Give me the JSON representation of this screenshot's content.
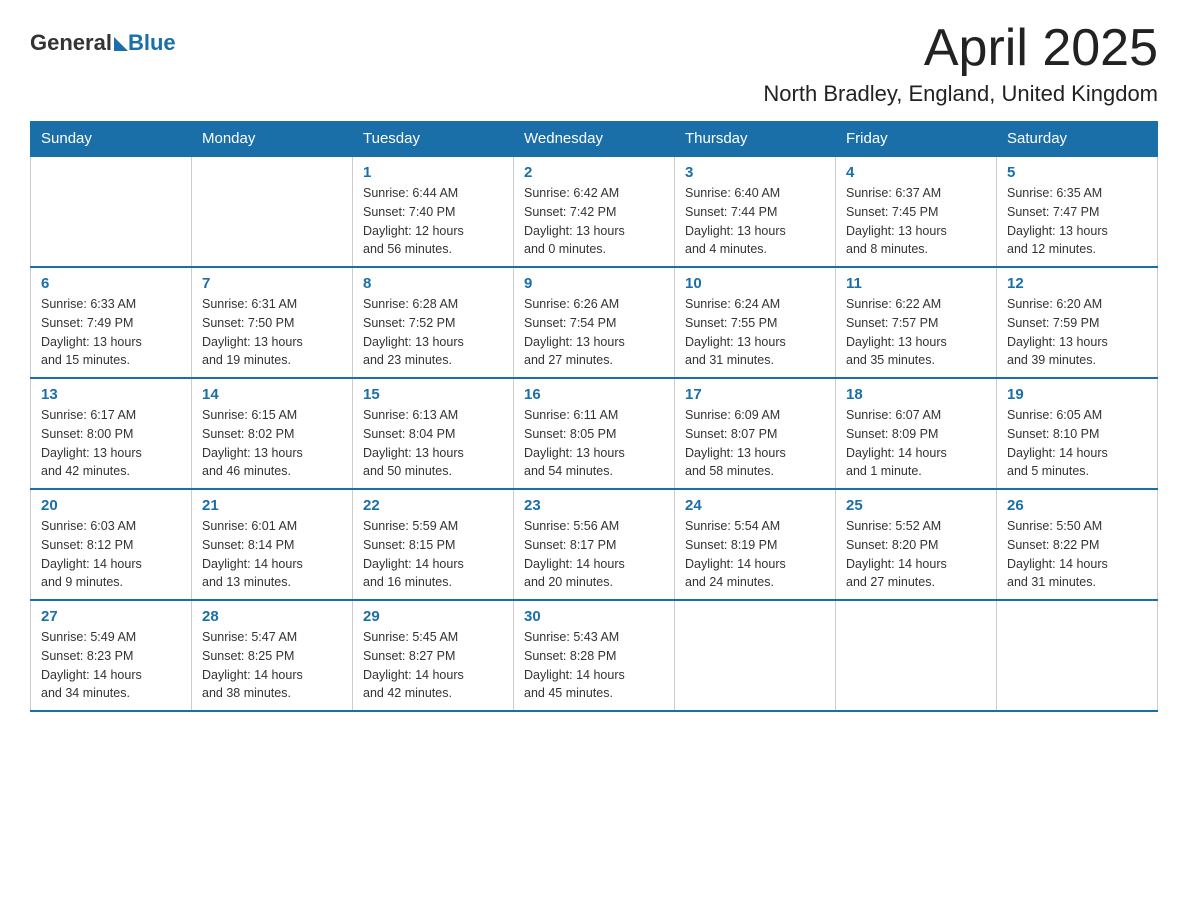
{
  "header": {
    "logo_general": "General",
    "logo_blue": "Blue",
    "month_title": "April 2025",
    "location": "North Bradley, England, United Kingdom"
  },
  "days_of_week": [
    "Sunday",
    "Monday",
    "Tuesday",
    "Wednesday",
    "Thursday",
    "Friday",
    "Saturday"
  ],
  "weeks": [
    [
      {
        "day": "",
        "info": ""
      },
      {
        "day": "",
        "info": ""
      },
      {
        "day": "1",
        "info": "Sunrise: 6:44 AM\nSunset: 7:40 PM\nDaylight: 12 hours\nand 56 minutes."
      },
      {
        "day": "2",
        "info": "Sunrise: 6:42 AM\nSunset: 7:42 PM\nDaylight: 13 hours\nand 0 minutes."
      },
      {
        "day": "3",
        "info": "Sunrise: 6:40 AM\nSunset: 7:44 PM\nDaylight: 13 hours\nand 4 minutes."
      },
      {
        "day": "4",
        "info": "Sunrise: 6:37 AM\nSunset: 7:45 PM\nDaylight: 13 hours\nand 8 minutes."
      },
      {
        "day": "5",
        "info": "Sunrise: 6:35 AM\nSunset: 7:47 PM\nDaylight: 13 hours\nand 12 minutes."
      }
    ],
    [
      {
        "day": "6",
        "info": "Sunrise: 6:33 AM\nSunset: 7:49 PM\nDaylight: 13 hours\nand 15 minutes."
      },
      {
        "day": "7",
        "info": "Sunrise: 6:31 AM\nSunset: 7:50 PM\nDaylight: 13 hours\nand 19 minutes."
      },
      {
        "day": "8",
        "info": "Sunrise: 6:28 AM\nSunset: 7:52 PM\nDaylight: 13 hours\nand 23 minutes."
      },
      {
        "day": "9",
        "info": "Sunrise: 6:26 AM\nSunset: 7:54 PM\nDaylight: 13 hours\nand 27 minutes."
      },
      {
        "day": "10",
        "info": "Sunrise: 6:24 AM\nSunset: 7:55 PM\nDaylight: 13 hours\nand 31 minutes."
      },
      {
        "day": "11",
        "info": "Sunrise: 6:22 AM\nSunset: 7:57 PM\nDaylight: 13 hours\nand 35 minutes."
      },
      {
        "day": "12",
        "info": "Sunrise: 6:20 AM\nSunset: 7:59 PM\nDaylight: 13 hours\nand 39 minutes."
      }
    ],
    [
      {
        "day": "13",
        "info": "Sunrise: 6:17 AM\nSunset: 8:00 PM\nDaylight: 13 hours\nand 42 minutes."
      },
      {
        "day": "14",
        "info": "Sunrise: 6:15 AM\nSunset: 8:02 PM\nDaylight: 13 hours\nand 46 minutes."
      },
      {
        "day": "15",
        "info": "Sunrise: 6:13 AM\nSunset: 8:04 PM\nDaylight: 13 hours\nand 50 minutes."
      },
      {
        "day": "16",
        "info": "Sunrise: 6:11 AM\nSunset: 8:05 PM\nDaylight: 13 hours\nand 54 minutes."
      },
      {
        "day": "17",
        "info": "Sunrise: 6:09 AM\nSunset: 8:07 PM\nDaylight: 13 hours\nand 58 minutes."
      },
      {
        "day": "18",
        "info": "Sunrise: 6:07 AM\nSunset: 8:09 PM\nDaylight: 14 hours\nand 1 minute."
      },
      {
        "day": "19",
        "info": "Sunrise: 6:05 AM\nSunset: 8:10 PM\nDaylight: 14 hours\nand 5 minutes."
      }
    ],
    [
      {
        "day": "20",
        "info": "Sunrise: 6:03 AM\nSunset: 8:12 PM\nDaylight: 14 hours\nand 9 minutes."
      },
      {
        "day": "21",
        "info": "Sunrise: 6:01 AM\nSunset: 8:14 PM\nDaylight: 14 hours\nand 13 minutes."
      },
      {
        "day": "22",
        "info": "Sunrise: 5:59 AM\nSunset: 8:15 PM\nDaylight: 14 hours\nand 16 minutes."
      },
      {
        "day": "23",
        "info": "Sunrise: 5:56 AM\nSunset: 8:17 PM\nDaylight: 14 hours\nand 20 minutes."
      },
      {
        "day": "24",
        "info": "Sunrise: 5:54 AM\nSunset: 8:19 PM\nDaylight: 14 hours\nand 24 minutes."
      },
      {
        "day": "25",
        "info": "Sunrise: 5:52 AM\nSunset: 8:20 PM\nDaylight: 14 hours\nand 27 minutes."
      },
      {
        "day": "26",
        "info": "Sunrise: 5:50 AM\nSunset: 8:22 PM\nDaylight: 14 hours\nand 31 minutes."
      }
    ],
    [
      {
        "day": "27",
        "info": "Sunrise: 5:49 AM\nSunset: 8:23 PM\nDaylight: 14 hours\nand 34 minutes."
      },
      {
        "day": "28",
        "info": "Sunrise: 5:47 AM\nSunset: 8:25 PM\nDaylight: 14 hours\nand 38 minutes."
      },
      {
        "day": "29",
        "info": "Sunrise: 5:45 AM\nSunset: 8:27 PM\nDaylight: 14 hours\nand 42 minutes."
      },
      {
        "day": "30",
        "info": "Sunrise: 5:43 AM\nSunset: 8:28 PM\nDaylight: 14 hours\nand 45 minutes."
      },
      {
        "day": "",
        "info": ""
      },
      {
        "day": "",
        "info": ""
      },
      {
        "day": "",
        "info": ""
      }
    ]
  ]
}
